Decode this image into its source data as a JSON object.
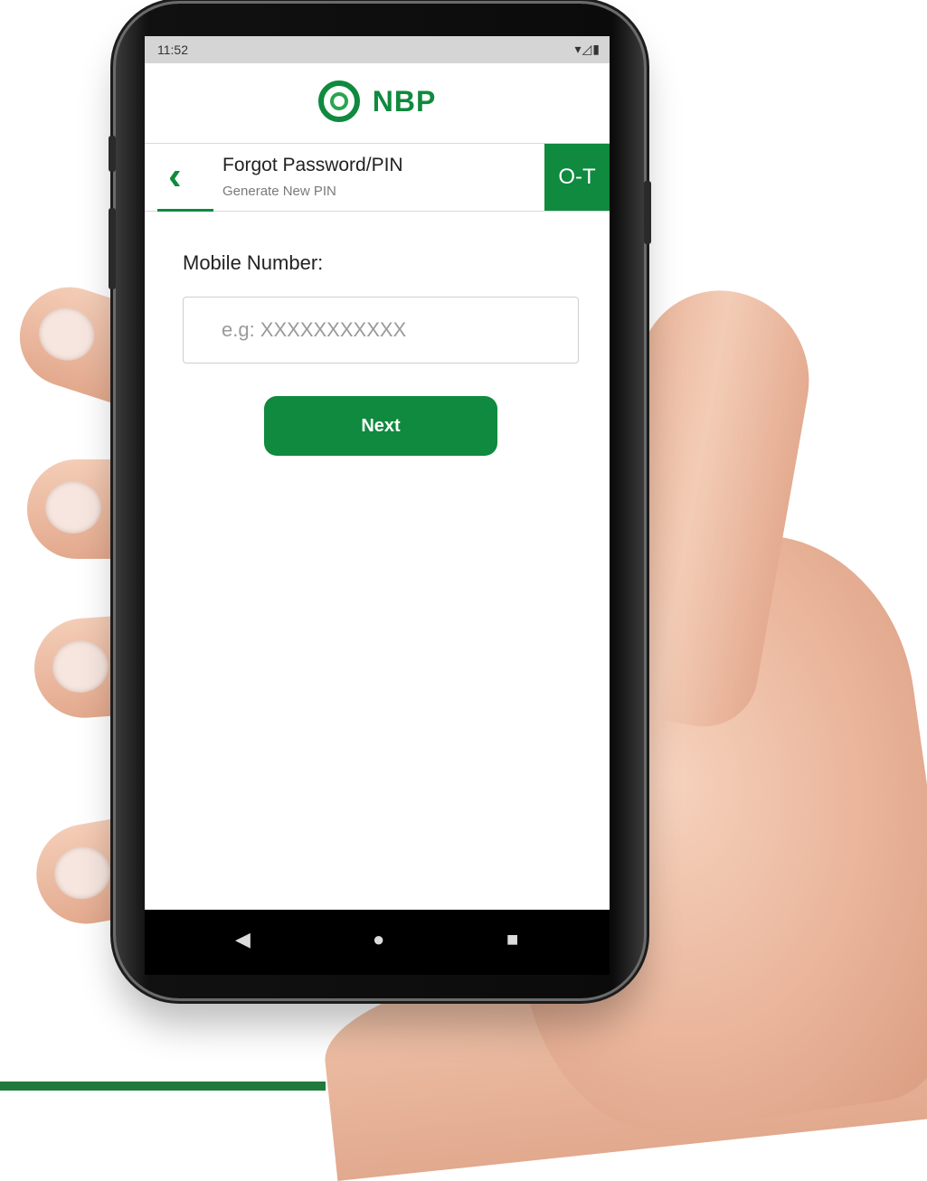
{
  "status_bar": {
    "time": "11:52",
    "icons": "▾◿▮"
  },
  "logo": {
    "text": "NBP"
  },
  "header": {
    "back_icon": "‹",
    "title": "Forgot Password/PIN",
    "subtitle": "Generate New PIN",
    "key_icon": "O‑T"
  },
  "form": {
    "mobile_label": "Mobile Number:",
    "mobile_placeholder": "e.g: XXXXXXXXXXX",
    "mobile_value": "",
    "next_label": "Next"
  },
  "nav": {
    "back": "◀",
    "home": "●",
    "recent": "■"
  },
  "colors": {
    "brand_green": "#0f8a3e",
    "status_bar_bg": "#d5d5d5",
    "nav_bar_bg": "#000000"
  }
}
